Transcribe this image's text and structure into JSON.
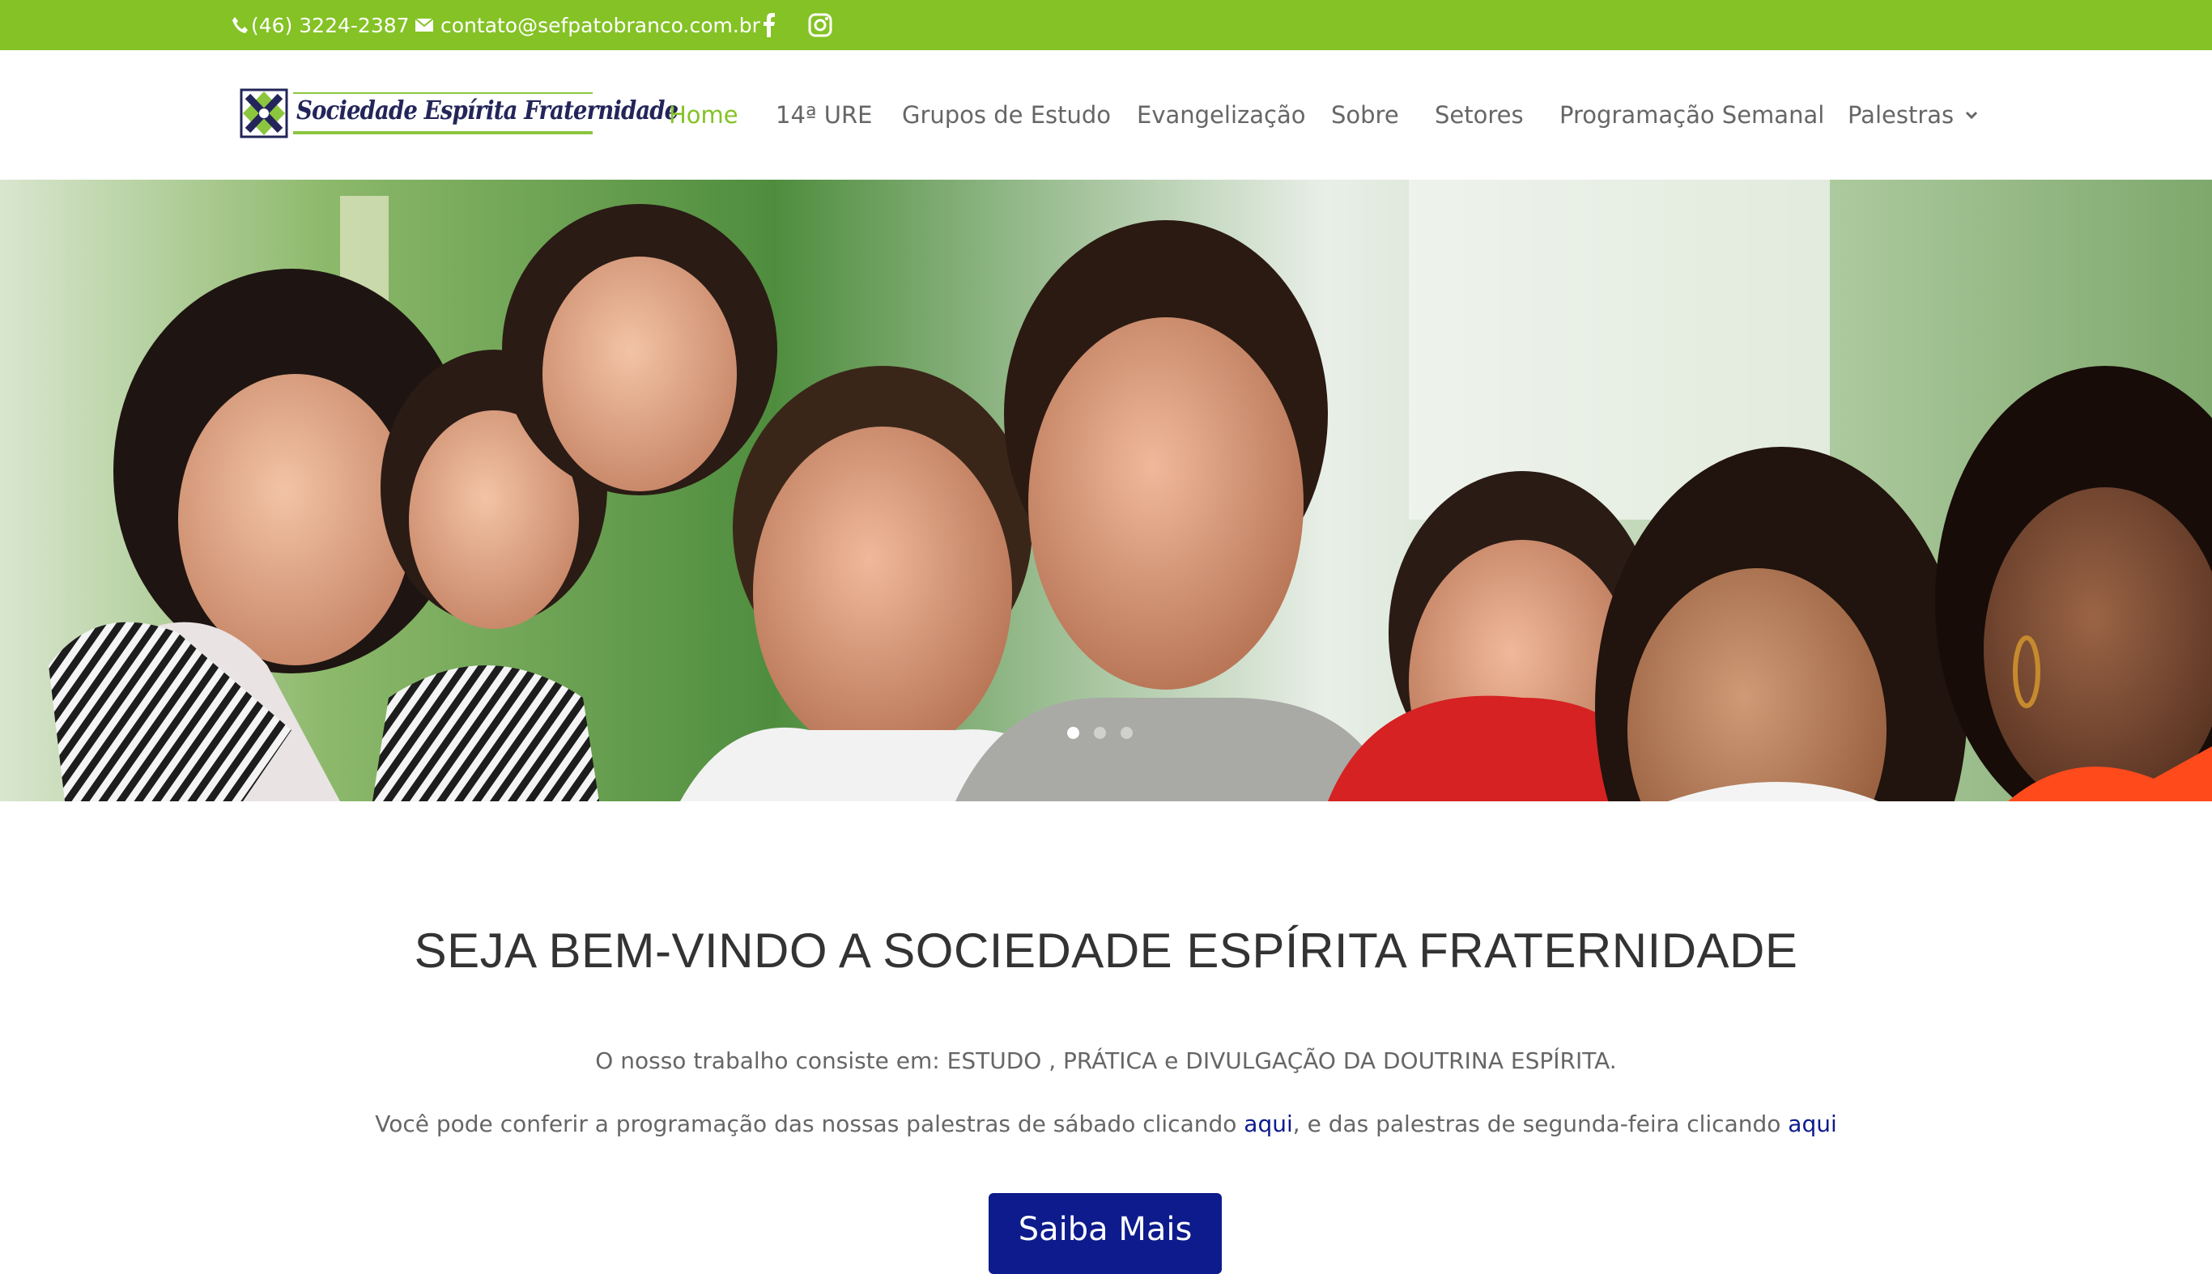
{
  "topbar": {
    "phone": "(46) 3224-2387",
    "email": "contato@sefpatobranco.com.br",
    "icons": [
      "phone-icon",
      "envelope-icon",
      "facebook-icon",
      "instagram-icon"
    ],
    "background": "#84c225"
  },
  "logo": {
    "text": "Sociedade Espírita Fraternidade"
  },
  "nav": {
    "items": [
      {
        "label": "Home",
        "active": true
      },
      {
        "label": "14ª URE"
      },
      {
        "label": "Grupos de Estudo"
      },
      {
        "label": "Evangelização"
      },
      {
        "label": "Sobre"
      },
      {
        "label": "Setores"
      },
      {
        "label": "Programação Semanal"
      },
      {
        "label": "Palestras",
        "has_dropdown": true
      }
    ],
    "active_color": "#84c225"
  },
  "hero": {
    "slides": 3,
    "active_slide": 1
  },
  "welcome": {
    "title": "SEJA BEM-VINDO A SOCIEDADE ESPÍRITA FRATERNIDADE",
    "line1": "O nosso trabalho consiste em: ESTUDO , PRÁTICA e DIVULGAÇÃO DA DOUTRINA ESPÍRITA.",
    "line2_a": "Você pode conferir a programação das nossas palestras de sábado clicando ",
    "link1": "aqui",
    "line2_b": ", e das palestras de segunda-feira clicando ",
    "link2": "aqui",
    "button": "Saiba Mais",
    "accent": "#0d1b8c"
  }
}
